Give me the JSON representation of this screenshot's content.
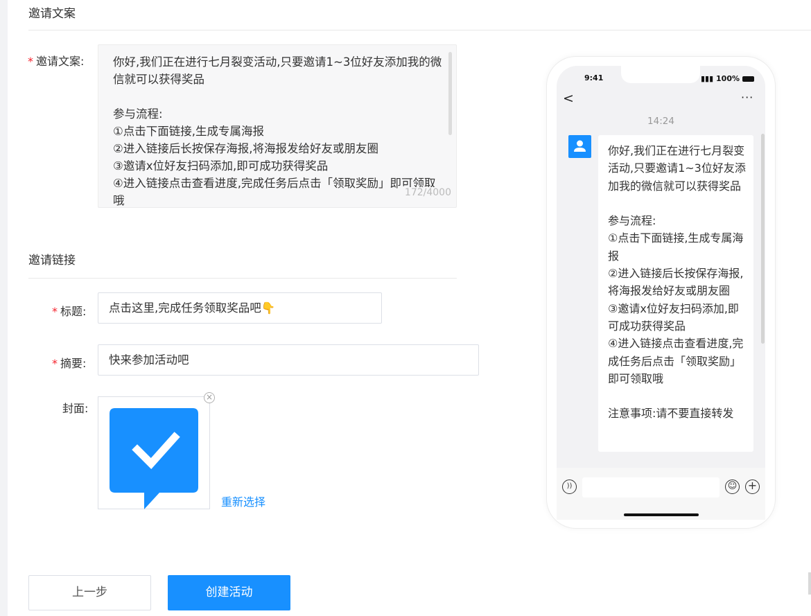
{
  "sections": {
    "invite_text_title": "邀请文案",
    "invite_link_title": "邀请链接"
  },
  "invite_text": {
    "label": "邀请文案:",
    "required_mark": "*",
    "content": "你好,我们正在进行七月裂变活动,只要邀请1~3位好友添加我的微信就可以获得奖品\n\n参与流程:\n①点击下面链接,生成专属海报\n②进入链接后长按保存海报,将海报发给好友或朋友圈\n③邀请x位好友扫码添加,即可成功获得奖品\n④进入链接点击查看进度,完成任务后点击「领取奖励」即可领取哦",
    "char_count": "172/4000"
  },
  "link": {
    "title_label": "标题:",
    "title_value": "点击这里,完成任务领取奖品吧👇",
    "summary_label": "摘要:",
    "summary_value": "快来参加活动吧",
    "cover_label": "封面:",
    "reselect": "重新选择",
    "remove_icon": "×",
    "required_mark": "*"
  },
  "buttons": {
    "prev": "上一步",
    "create": "创建活动"
  },
  "preview": {
    "status_time": "9:41",
    "battery": "100%",
    "back_glyph": "<",
    "more_glyph": "···",
    "chat_time": "14:24",
    "voice_glyph": "))",
    "emoji_glyph": "☺",
    "plus_glyph": "+",
    "message": "你好,我们正在进行七月裂变活动,只要邀请1~3位好友添加我的微信就可以获得奖品\n\n参与流程:\n①点击下面链接,生成专属海报\n②进入链接后长按保存海报,将海报发给好友或朋友圈\n③邀请x位好友扫码添加,即可成功获得奖品\n④进入链接点击查看进度,完成任务后点击「领取奖励」即可领取哦\n\n注意事项:请不要直接转发"
  },
  "colors": {
    "primary": "#1890ff",
    "required": "#f5222d"
  }
}
